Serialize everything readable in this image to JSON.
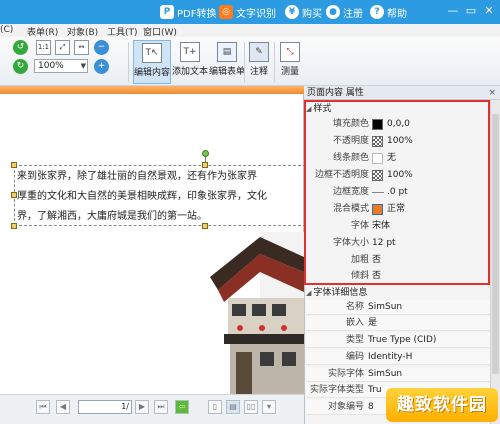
{
  "titlebar": {
    "pdf_convert": "PDF转换",
    "ocr": "文字识别",
    "buy": "购买",
    "register": "注册",
    "help": "帮助"
  },
  "menu": {
    "items": [
      "(C)",
      "表单(R)",
      "对象(B)",
      "工具(T)",
      "窗口(W)"
    ]
  },
  "toolbar": {
    "zoom": "100%",
    "edit_content": "编辑内容",
    "add_text": "添加文本",
    "edit_form": "编辑表单",
    "annotate": "注释",
    "measure": "测量"
  },
  "document": {
    "lines": [
      "来到张家界，除了雄壮丽的自然景观，还有作为张家界",
      "厚重的文化和大自然的美景相映成辉，印象张家界，文化",
      "界，了解湘西，大庸府城是我们的第一站。"
    ]
  },
  "pagenav": {
    "page": "1/",
    "zoom_ctrl": "8"
  },
  "panel": {
    "title": "页面内容 属性",
    "close": "×",
    "style_section": "样式",
    "style_rows": [
      {
        "label": "填充颜色",
        "value": "0,0,0",
        "swatch": "#000000"
      },
      {
        "label": "不透明度",
        "value": "100%",
        "swatch": "checker"
      },
      {
        "label": "线条颜色",
        "value": "无",
        "swatch": "none"
      },
      {
        "label": "边框不透明度",
        "value": "100%",
        "swatch": "checker"
      },
      {
        "label": "边框宽度",
        "value": ".0 pt",
        "swatch": "line"
      },
      {
        "label": "混合模式",
        "value": "正常",
        "swatch": "#f07a20"
      },
      {
        "label": "字体",
        "value": "宋体",
        "swatch": ""
      },
      {
        "label": "字体大小",
        "value": "12 pt",
        "swatch": ""
      },
      {
        "label": "加粗",
        "value": "否",
        "swatch": ""
      },
      {
        "label": "倾斜",
        "value": "否",
        "swatch": ""
      }
    ],
    "font_section": "字体详细信息",
    "font_rows": [
      {
        "label": "名称",
        "value": "SimSun"
      },
      {
        "label": "嵌入",
        "value": "是"
      },
      {
        "label": "类型",
        "value": "True Type (CID)"
      },
      {
        "label": "编码",
        "value": "Identity-H"
      },
      {
        "label": "实际字体",
        "value": "SimSun"
      },
      {
        "label": "实际字体类型",
        "value": "Tru"
      },
      {
        "label": "对象编号",
        "value": "8"
      }
    ]
  },
  "watermark": "趣致软件园",
  "colors": {
    "titlebar": "#2d9be2",
    "highlight_box": "#e03030",
    "accent_orange": "#f08a2e"
  }
}
